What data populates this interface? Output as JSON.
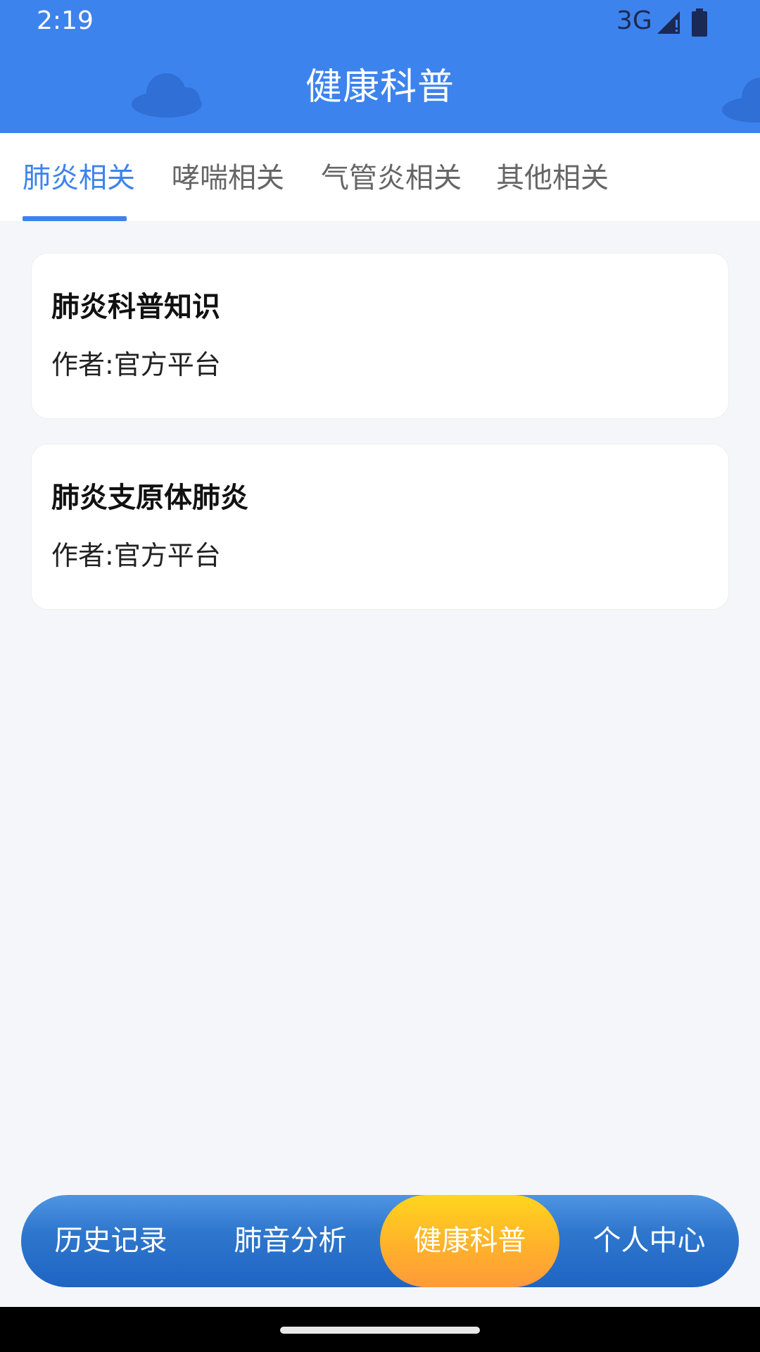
{
  "status_bar": {
    "time": "2:19",
    "network": "3G",
    "icons": [
      "signal-icon",
      "battery-icon"
    ]
  },
  "header": {
    "title": "健康科普",
    "decorations": [
      "cloud-icon",
      "cloud-icon"
    ]
  },
  "tabs": [
    {
      "label": "肺炎相关",
      "active": true
    },
    {
      "label": "哮喘相关",
      "active": false
    },
    {
      "label": "气管炎相关",
      "active": false
    },
    {
      "label": "其他相关",
      "active": false
    }
  ],
  "articles": [
    {
      "title": "肺炎科普知识",
      "author": "作者:官方平台"
    },
    {
      "title": "肺炎支原体肺炎",
      "author": "作者:官方平台"
    }
  ],
  "bottom_nav": [
    {
      "label": "历史记录",
      "active": false
    },
    {
      "label": "肺音分析",
      "active": false
    },
    {
      "label": "健康科普",
      "active": true
    },
    {
      "label": "个人中心",
      "active": false
    }
  ],
  "colors": {
    "primary": "#3d83ee",
    "nav_gradient_top": "#4e95e3",
    "nav_gradient_bottom": "#1e64c4",
    "active_nav_top": "#ffd51e",
    "active_nav_bottom": "#ff9a3a",
    "background": "#f5f6fa",
    "cloud": "#2f6fd6"
  }
}
